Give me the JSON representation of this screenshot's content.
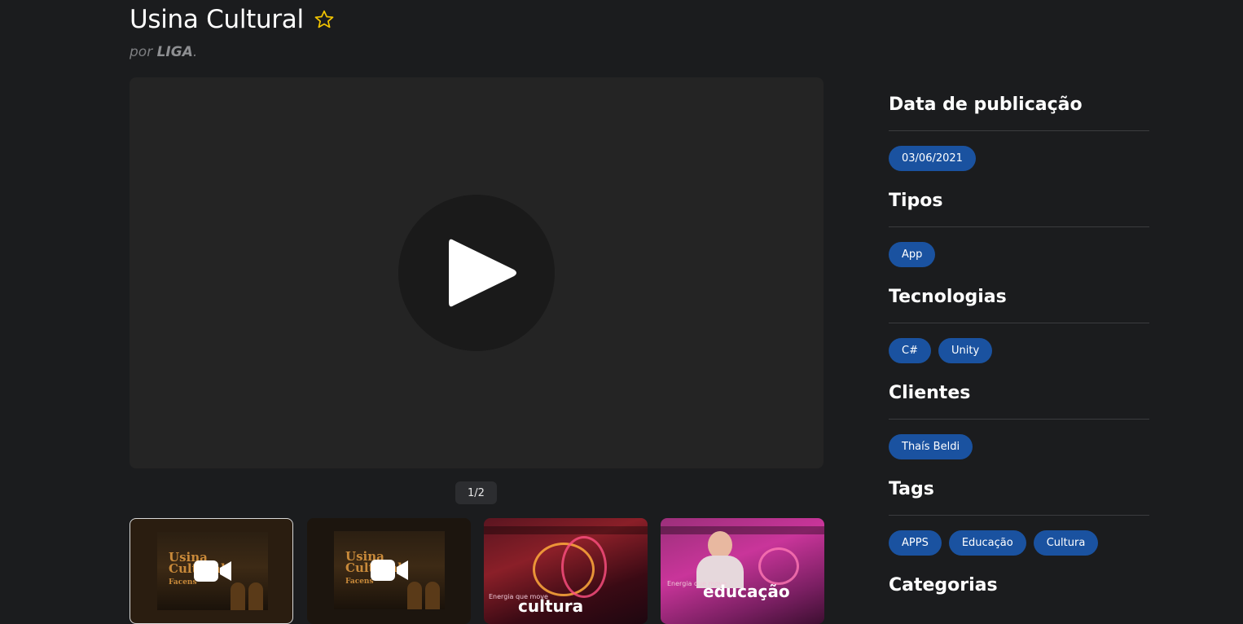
{
  "project": {
    "title": "Usina Cultural",
    "by_prefix": "por",
    "author": "LIGA",
    "by_suffix": "."
  },
  "gallery": {
    "counter": "1/2",
    "thumbnails": [
      {
        "kind": "video",
        "logo_lines": [
          "Usina",
          "Cultural"
        ],
        "brand": "Facens"
      },
      {
        "kind": "video",
        "logo_lines": [
          "Usina",
          "Cultural"
        ],
        "brand": "Facens"
      },
      {
        "kind": "image",
        "caption_small": "Energia que move",
        "caption_big": "cultura"
      },
      {
        "kind": "image",
        "caption_small": "Energia que move",
        "caption_big": "educação"
      }
    ]
  },
  "sidebar": {
    "sections": [
      {
        "title": "Data de publicação",
        "pills": [
          "03/06/2021"
        ]
      },
      {
        "title": "Tipos",
        "pills": [
          "App"
        ]
      },
      {
        "title": "Tecnologias",
        "pills": [
          "C#",
          "Unity"
        ]
      },
      {
        "title": "Clientes",
        "pills": [
          "Thaís Beldi"
        ]
      },
      {
        "title": "Tags",
        "pills": [
          "APPS",
          "Educação",
          "Cultura"
        ]
      },
      {
        "title": "Categorias",
        "pills": []
      }
    ]
  },
  "colors": {
    "background": "#1b1c1e",
    "player": "#242424",
    "pill": "#1a52a0",
    "star": "#f2c400"
  },
  "icons": [
    "star-outline-icon",
    "play-icon",
    "video-camera-icon"
  ]
}
